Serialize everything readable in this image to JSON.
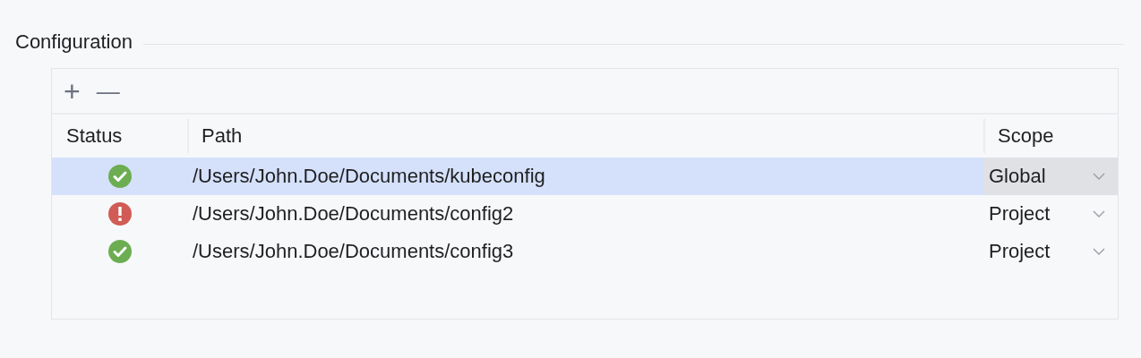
{
  "section": {
    "title": "Configuration"
  },
  "toolbar": {
    "add": "+",
    "remove": "—"
  },
  "table": {
    "columns": [
      "Status",
      "Path",
      "Scope"
    ],
    "rows": [
      {
        "kind": "ok",
        "path": "/Users/John.Doe/Documents/kubeconfig",
        "scope": "Global",
        "selected": true
      },
      {
        "kind": "error",
        "path": "/Users/John.Doe/Documents/config2",
        "scope": "Project",
        "selected": false
      },
      {
        "kind": "ok",
        "path": "/Users/John.Doe/Documents/config3",
        "scope": "Project",
        "selected": false
      }
    ]
  }
}
